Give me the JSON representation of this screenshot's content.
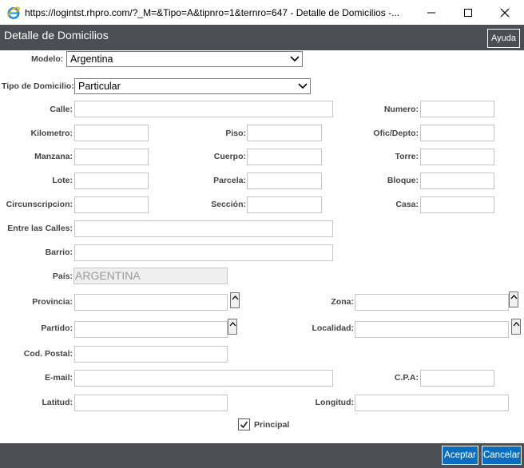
{
  "window": {
    "title": "https://logintst.rhpro.com/?_M=&Tipo=A&tipnro=1&ternro=647 - Detalle de Domicilios -..."
  },
  "header": {
    "title": "Detalle de Domicilios",
    "help_label": "Ayuda"
  },
  "form": {
    "modelo_label": "Modelo:",
    "modelo_value": "Argentina",
    "tipo_label": "Tipo de Domicilio:",
    "tipo_value": "Particular",
    "calle": "Calle:",
    "numero": "Numero:",
    "kilometro": "Kilometro:",
    "piso": "Piso:",
    "ofic": "Ofic/Depto:",
    "manzana": "Manzana:",
    "cuerpo": "Cuerpo:",
    "torre": "Torre:",
    "lote": "Lote:",
    "parcela": "Parcela:",
    "bloque": "Bloque:",
    "circunscripcion": "Circunscripcion:",
    "seccion": "Sección:",
    "casa": "Casa:",
    "entre_calles": "Entre las Calles:",
    "barrio": "Barrio:",
    "pais_label": "País:",
    "pais_value": "ARGENTINA",
    "provincia": "Provincia:",
    "zona": "Zona:",
    "partido": "Partido:",
    "localidad": "Localidad:",
    "cod_postal": "Cod. Postal:",
    "email": "E-mail:",
    "cpa": "C.P.A:",
    "latitud": "Latitud:",
    "longitud": "Longitud:",
    "principal_label": "Principal",
    "principal_checked": true
  },
  "footer": {
    "accept_label": "Aceptar",
    "cancel_label": "Cancelar"
  },
  "colors": {
    "header_bg": "#4b4e54",
    "primary_button": "#0a6ebd"
  }
}
